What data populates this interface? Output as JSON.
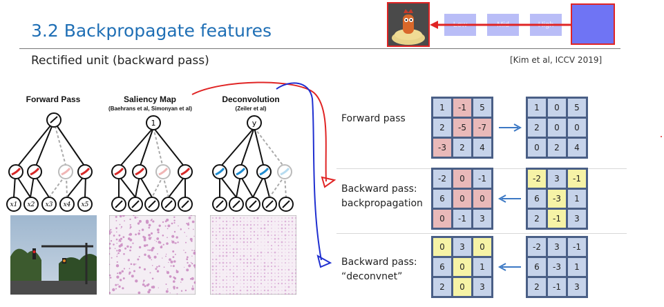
{
  "slide": {
    "title": "3.2 Backpropagate features",
    "subtitle": "Rectified unit (backward pass)",
    "citation": "[Kim et al, ICCV 2019]"
  },
  "level_indicator": {
    "levels": [
      "Low",
      "Mid",
      "High"
    ]
  },
  "figure": {
    "panels": [
      {
        "title": "Forward Pass",
        "sub": ""
      },
      {
        "title": "Saliency Map",
        "sub": "(Baehrans et al, Simonyan et al)"
      },
      {
        "title": "Deconvolution",
        "sub": "(Zeiler et al)"
      }
    ],
    "input_labels": [
      "x1",
      "x2",
      "x3",
      "x4",
      "x5"
    ],
    "top_labels": [
      "",
      "1",
      "y"
    ]
  },
  "rows": [
    {
      "label_lines": [
        "Forward pass"
      ],
      "left": [
        [
          "1",
          "-1",
          "5"
        ],
        [
          "2",
          "-5",
          "-7"
        ],
        [
          "-3",
          "2",
          "4"
        ]
      ],
      "left_colors": [
        [
          "b",
          "p",
          "b"
        ],
        [
          "b",
          "p",
          "p"
        ],
        [
          "p",
          "b",
          "b"
        ]
      ],
      "right": [
        [
          "1",
          "0",
          "5"
        ],
        [
          "2",
          "0",
          "0"
        ],
        [
          "0",
          "2",
          "4"
        ]
      ],
      "right_colors": [
        [
          "b",
          "b",
          "b"
        ],
        [
          "b",
          "b",
          "b"
        ],
        [
          "b",
          "b",
          "b"
        ]
      ],
      "arrow": "right"
    },
    {
      "label_lines": [
        "Backward pass:",
        "backpropagation"
      ],
      "left": [
        [
          "-2",
          "0",
          "-1"
        ],
        [
          "6",
          "0",
          "0"
        ],
        [
          "0",
          "-1",
          "3"
        ]
      ],
      "left_colors": [
        [
          "b",
          "p",
          "b"
        ],
        [
          "b",
          "p",
          "p"
        ],
        [
          "p",
          "b",
          "b"
        ]
      ],
      "right": [
        [
          "-2",
          "3",
          "-1"
        ],
        [
          "6",
          "-3",
          "1"
        ],
        [
          "2",
          "-1",
          "3"
        ]
      ],
      "right_colors": [
        [
          "y",
          "b",
          "y"
        ],
        [
          "b",
          "y",
          "b"
        ],
        [
          "b",
          "y",
          "b"
        ]
      ],
      "arrow": "left"
    },
    {
      "label_lines": [
        "Backward pass:",
        "“deconvnet”"
      ],
      "left": [
        [
          "0",
          "3",
          "0"
        ],
        [
          "6",
          "0",
          "1"
        ],
        [
          "2",
          "0",
          "3"
        ]
      ],
      "left_colors": [
        [
          "y",
          "b",
          "y"
        ],
        [
          "b",
          "y",
          "b"
        ],
        [
          "b",
          "y",
          "b"
        ]
      ],
      "right": [
        [
          "-2",
          "3",
          "-1"
        ],
        [
          "6",
          "-3",
          "1"
        ],
        [
          "2",
          "-1",
          "3"
        ]
      ],
      "right_colors": [
        [
          "b",
          "b",
          "b"
        ],
        [
          "b",
          "b",
          "b"
        ],
        [
          "b",
          "b",
          "b"
        ]
      ],
      "arrow": "left"
    }
  ],
  "colors": {
    "title_blue": "#1f6fb5",
    "grid_border": "#4a5f86",
    "cell_blue": "#c6d3ea",
    "cell_pink": "#e9b9b9",
    "cell_yellow": "#f6f3a6",
    "annotation_red": "#e02424",
    "annotation_blue": "#1f2fd0",
    "arrow_blue": "#3b78c4"
  }
}
